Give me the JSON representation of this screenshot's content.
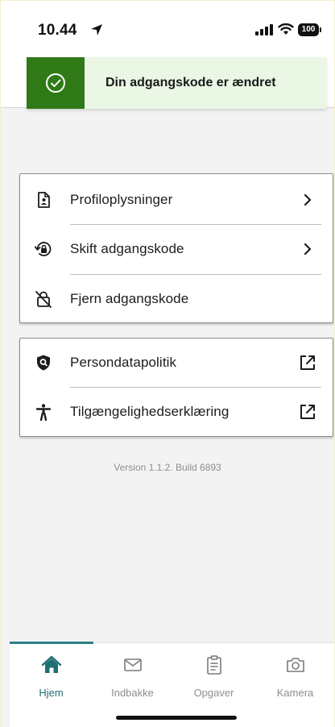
{
  "status_bar": {
    "time": "10.44",
    "battery": "100"
  },
  "toast": {
    "message": "Din adgangskode er ændret"
  },
  "menu_card_1": {
    "items": [
      {
        "label": "Profiloplysninger",
        "icon": "profile-document-icon",
        "trailing": "chevron-right"
      },
      {
        "label": "Skift adgangskode",
        "icon": "lock-refresh-icon",
        "trailing": "chevron-right"
      },
      {
        "label": "Fjern adgangskode",
        "icon": "lock-off-icon",
        "trailing": ""
      }
    ]
  },
  "menu_card_2": {
    "items": [
      {
        "label": "Persondatapolitik",
        "icon": "shield-search-icon",
        "trailing": "external-link"
      },
      {
        "label": "Tilgængelighedserklæring",
        "icon": "accessibility-icon",
        "trailing": "external-link"
      }
    ]
  },
  "version_text": "Version 1.1.2. Build 6893",
  "tab_bar": {
    "active": "Hjem",
    "tabs": [
      {
        "label": "Hjem",
        "icon": "home-icon"
      },
      {
        "label": "Indbakke",
        "icon": "mail-icon"
      },
      {
        "label": "Opgaver",
        "icon": "clipboard-icon"
      },
      {
        "label": "Kamera",
        "icon": "camera-icon"
      }
    ]
  },
  "colors": {
    "toast_accent": "#2f7a17",
    "toast_bg": "#eaf7e4",
    "tab_active": "#1f6e75"
  }
}
